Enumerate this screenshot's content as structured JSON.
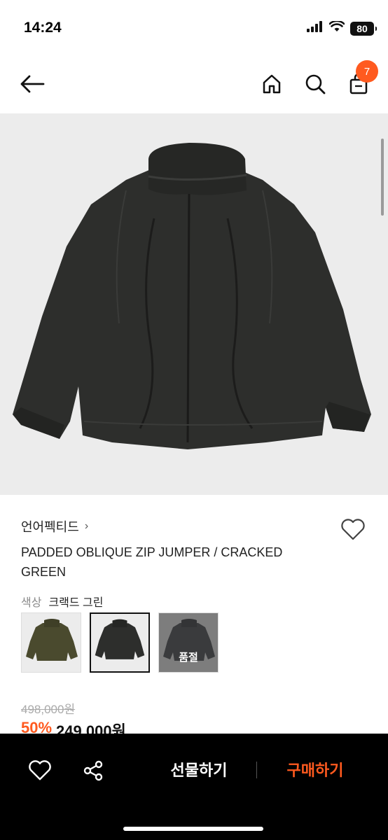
{
  "status_bar": {
    "time": "14:24",
    "battery": "80",
    "icons": [
      "signal-icon",
      "wifi-icon",
      "battery-icon"
    ]
  },
  "nav": {
    "cart_count": "7",
    "icons": [
      "back-arrow-icon",
      "home-icon",
      "search-icon",
      "shopping-bag-icon"
    ]
  },
  "product": {
    "brand": "언어펙티드",
    "title": "PADDED OBLIQUE ZIP JUMPER / CRACKED GREEN",
    "color_label": "색상",
    "color_value": "크랙드 그린",
    "swatches": [
      {
        "color": "#4a4a2e",
        "sold_out": false
      },
      {
        "color": "#2d2e2c",
        "sold_out": false,
        "selected": true
      },
      {
        "color": "#3a3b3d",
        "sold_out": true,
        "label": "품절"
      }
    ],
    "original_price": "498,000원",
    "discount": "50%",
    "price": "249,000원"
  },
  "bottom_bar": {
    "gift_label": "선물하기",
    "buy_label": "구매하기"
  },
  "colors": {
    "accent": "#ff5a1f",
    "jacket": "#2d2e2c",
    "image_bg": "#ececec"
  }
}
